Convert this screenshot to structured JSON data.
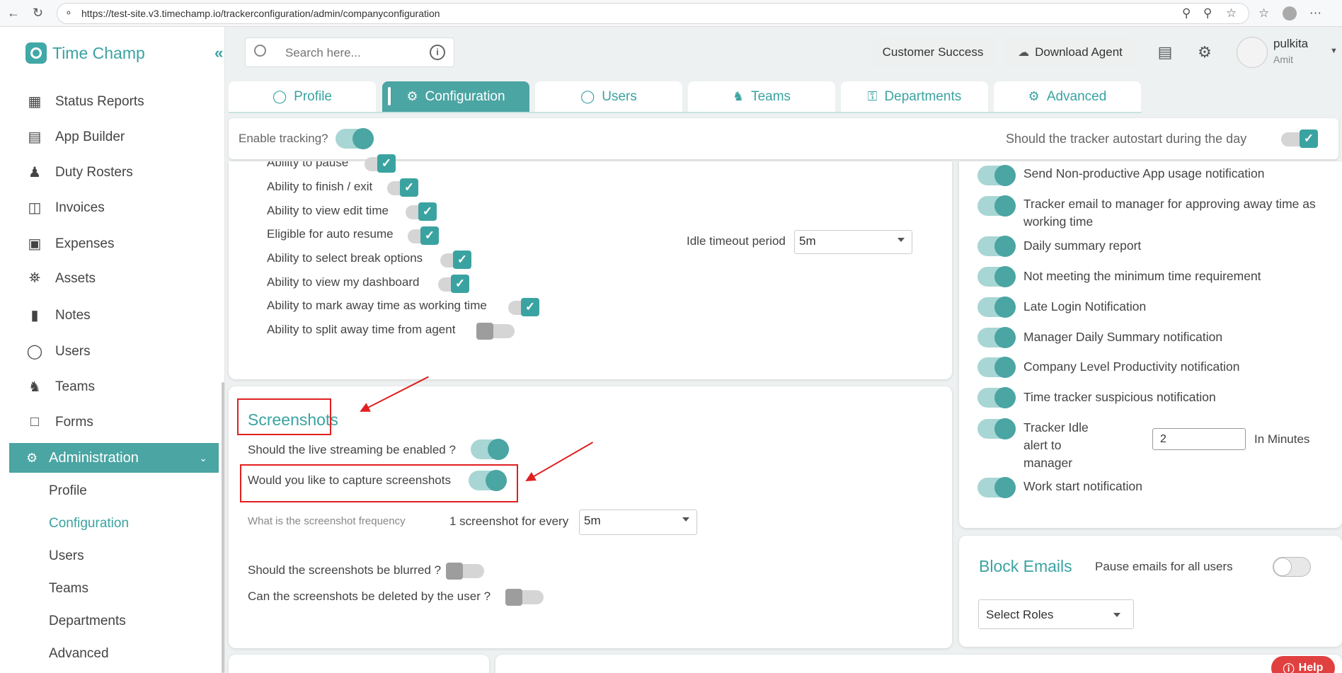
{
  "browser": {
    "url": "https://test-site.v3.timechamp.io/trackerconfiguration/admin/companyconfiguration"
  },
  "app": {
    "name": "Time Champ"
  },
  "sidebar": {
    "items": [
      {
        "label": "Status Reports",
        "icon": "dashboard-icon"
      },
      {
        "label": "App Builder",
        "icon": "app-builder-icon"
      },
      {
        "label": "Duty Rosters",
        "icon": "duty-roster-icon"
      },
      {
        "label": "Invoices",
        "icon": "invoice-icon"
      },
      {
        "label": "Expenses",
        "icon": "wallet-icon"
      },
      {
        "label": "Assets",
        "icon": "bank-icon"
      },
      {
        "label": "Notes",
        "icon": "note-icon"
      },
      {
        "label": "Users",
        "icon": "user-icon"
      },
      {
        "label": "Teams",
        "icon": "teams-icon"
      },
      {
        "label": "Forms",
        "icon": "form-icon"
      }
    ],
    "admin": {
      "label": "Administration",
      "icon": "gear-icon"
    },
    "subitems": [
      "Profile",
      "Configuration",
      "Users",
      "Teams",
      "Departments",
      "Advanced"
    ],
    "active_subitem": "Configuration"
  },
  "header": {
    "search_placeholder": "Search here...",
    "customer_success": "Customer Success",
    "download_agent": "Download Agent",
    "user_name": "pulkita",
    "user_role": "Amit"
  },
  "tabs": [
    {
      "label": "Profile",
      "icon": "user-icon"
    },
    {
      "label": "Configuration",
      "icon": "gears-icon"
    },
    {
      "label": "Users",
      "icon": "users-icon"
    },
    {
      "label": "Teams",
      "icon": "teams-icon"
    },
    {
      "label": "Departments",
      "icon": "departments-icon"
    },
    {
      "label": "Advanced",
      "icon": "advanced-gear-icon"
    }
  ],
  "active_tab": "Configuration",
  "tracking": {
    "enable_label": "Enable tracking?",
    "autostart_label": "Should the tracker autostart during the day"
  },
  "abilities": [
    {
      "label": "Ability to pause",
      "on": true
    },
    {
      "label": "Ability to finish / exit",
      "on": true
    },
    {
      "label": "Ability to view edit time",
      "on": true
    },
    {
      "label": "Eligible for auto resume",
      "on": true
    },
    {
      "label": "Ability to select break options",
      "on": true
    },
    {
      "label": "Ability to view my dashboard",
      "on": true
    },
    {
      "label": "Ability to mark away time as working time",
      "on": true
    },
    {
      "label": "Ability to split away time from agent",
      "on": false
    }
  ],
  "idle": {
    "label": "Idle timeout period",
    "value": "5m"
  },
  "screenshots": {
    "title": "Screenshots",
    "live_streaming": "Should the live streaming be enabled ?",
    "capture": "Would you like to capture screenshots",
    "frequency_label": "What is the screenshot frequency",
    "frequency_prefix": "1 screenshot for every",
    "frequency_value": "5m",
    "blurred": "Should the screenshots be blurred ?",
    "deleted": "Can the screenshots be deleted by the user ?"
  },
  "notifications": [
    "Send Non-productive App usage notification",
    "Tracker email to manager for approving away time as working time",
    "Daily summary report",
    "Not meeting the minimum time requirement",
    "Late Login Notification",
    "Manager Daily Summary notification",
    "Company Level Productivity notification",
    "Time tracker suspicious notification",
    "Tracker Idle alert to manager",
    "Work start notification"
  ],
  "idle_alert": {
    "value": "2",
    "unit": "In Minutes"
  },
  "block_emails": {
    "title": "Block Emails",
    "pause_label": "Pause emails for all users",
    "roles_placeholder": "Select Roles"
  },
  "help": {
    "label": "Help"
  },
  "colors": {
    "accent": "#4aa5a3",
    "annotation": "#e02020"
  }
}
